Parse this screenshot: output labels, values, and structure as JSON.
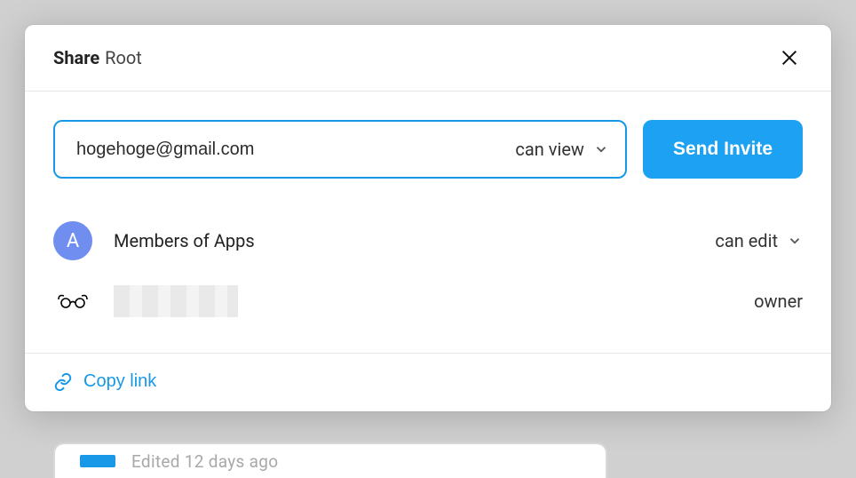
{
  "header": {
    "title_prefix": "Share",
    "title_name": "Root"
  },
  "invite": {
    "email_value": "hogehoge@gmail.com",
    "permission_label": "can view",
    "send_button": "Send Invite"
  },
  "members": [
    {
      "avatar_letter": "A",
      "avatar_color": "#6f8ef0",
      "name": "Members of Apps",
      "role": "can edit",
      "role_dropdown": true
    },
    {
      "avatar_type": "image",
      "name_redacted": true,
      "role": "owner",
      "role_dropdown": false
    }
  ],
  "footer": {
    "copy_link": "Copy link"
  },
  "background": {
    "edited_text": "Edited 12 days ago"
  }
}
